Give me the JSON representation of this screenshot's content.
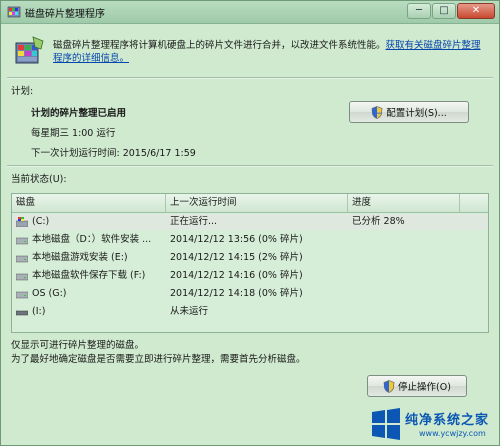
{
  "window": {
    "title": "磁盘碎片整理程序",
    "icon": "defrag-app-icon",
    "controls": {
      "minimize": "─",
      "maximize": "□",
      "close": "✕"
    }
  },
  "intro": {
    "text": "磁盘碎片整理程序将计算机硬盘上的碎片文件进行合并，以改进文件系统性能。",
    "link": "获取有关磁盘碎片整理程序的详细信息。"
  },
  "schedule": {
    "section_label": "计划:",
    "status_title": "计划的碎片整理已启用",
    "frequency": "每星期三  1:00 运行",
    "next_run": "下一次计划运行时间: 2015/6/17 1:59",
    "configure_button": "配置计划(S)..."
  },
  "current_status": {
    "section_label": "当前状态(U):",
    "columns": [
      "磁盘",
      "上一次运行时间",
      "进度"
    ],
    "rows": [
      {
        "disk": "(C:)",
        "last_run": "正在运行...",
        "progress": "已分析  28%",
        "icon": "system-drive-icon"
      },
      {
        "disk": "本地磁盘（D：）软件安装 ...",
        "last_run": "2014/12/12 13:56 (0% 碎片)",
        "progress": "",
        "icon": "hard-drive-icon"
      },
      {
        "disk": "本地磁盘游戏安装 (E:)",
        "last_run": "2014/12/12 14:15 (2% 碎片)",
        "progress": "",
        "icon": "hard-drive-icon"
      },
      {
        "disk": "本地磁盘软件保存下载 (F:)",
        "last_run": "2014/12/12 14:16 (0% 碎片)",
        "progress": "",
        "icon": "hard-drive-icon"
      },
      {
        "disk": "OS (G:)",
        "last_run": "2014/12/12 14:18 (0% 碎片)",
        "progress": "",
        "icon": "hard-drive-icon"
      },
      {
        "disk": "(I:)",
        "last_run": "从未运行",
        "progress": "",
        "icon": "removable-drive-icon"
      }
    ]
  },
  "footer": {
    "note1": "仅显示可进行碎片整理的磁盘。",
    "note2": "为了最好地确定磁盘是否需要立即进行碎片整理，需要首先分析磁盘。",
    "stop_button": "停止操作(O)"
  },
  "watermark": {
    "title": "纯净系统之家",
    "url": "www.ycwjzy.com"
  },
  "colors": {
    "window_bg": "#cfeacf",
    "link": "#0645ad",
    "watermark": "#0b57b3"
  }
}
